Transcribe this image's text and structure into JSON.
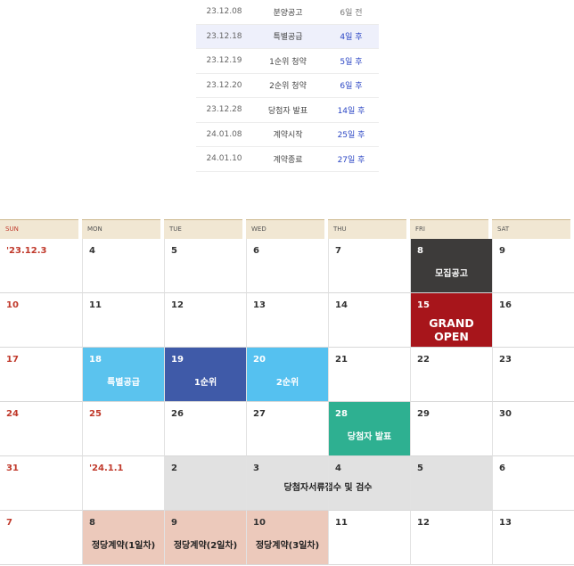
{
  "schedule": [
    {
      "date": "23.12.08",
      "event": "분양공고",
      "dday": "6일 전",
      "future": false,
      "highlight": false
    },
    {
      "date": "23.12.18",
      "event": "특별공급",
      "dday": "4일 후",
      "future": true,
      "highlight": true
    },
    {
      "date": "23.12.19",
      "event": "1순위 청약",
      "dday": "5일 후",
      "future": true,
      "highlight": false
    },
    {
      "date": "23.12.20",
      "event": "2순위 청약",
      "dday": "6일 후",
      "future": true,
      "highlight": false
    },
    {
      "date": "23.12.28",
      "event": "당첨자 발표",
      "dday": "14일 후",
      "future": true,
      "highlight": false
    },
    {
      "date": "24.01.08",
      "event": "계약시작",
      "dday": "25일 후",
      "future": true,
      "highlight": false
    },
    {
      "date": "24.01.10",
      "event": "계약종료",
      "dday": "27일 후",
      "future": true,
      "highlight": false
    }
  ],
  "calendar": {
    "weekdays": [
      "SUN",
      "MON",
      "TUE",
      "WED",
      "THU",
      "FRI",
      "SAT"
    ],
    "colors": {
      "recruit": "#3d3b3a",
      "open": "#a7151b",
      "special": "#5bc3ee",
      "first": "#3f5aa8",
      "second": "#55c1f0",
      "winner": "#2eb091",
      "docs": "#e1e1e1",
      "contract": "#ecc9bb",
      "sunday": "#c0392b"
    },
    "weeks": [
      {
        "days": [
          {
            "num": "'23.12.3",
            "red": true
          },
          {
            "num": "4"
          },
          {
            "num": "5"
          },
          {
            "num": "6"
          },
          {
            "num": "7"
          },
          {
            "num": "8",
            "event": "모집공고",
            "bg": "#3d3b3a",
            "white": true
          },
          {
            "num": "9"
          }
        ]
      },
      {
        "days": [
          {
            "num": "10",
            "red": true
          },
          {
            "num": "11"
          },
          {
            "num": "12"
          },
          {
            "num": "13"
          },
          {
            "num": "14"
          },
          {
            "num": "15",
            "event": "GRAND OPEN",
            "bg": "#a7151b",
            "white": true,
            "big": true
          },
          {
            "num": "16"
          }
        ]
      },
      {
        "days": [
          {
            "num": "17",
            "red": true
          },
          {
            "num": "18",
            "event": "특별공급",
            "bg": "#5bc3ee",
            "white": true
          },
          {
            "num": "19",
            "event": "1순위",
            "bg": "#3f5aa8",
            "white": true
          },
          {
            "num": "20",
            "event": "2순위",
            "bg": "#55c1f0",
            "white": true
          },
          {
            "num": "21"
          },
          {
            "num": "22"
          },
          {
            "num": "23"
          }
        ]
      },
      {
        "days": [
          {
            "num": "24",
            "red": true
          },
          {
            "num": "25",
            "red": true
          },
          {
            "num": "26"
          },
          {
            "num": "27"
          },
          {
            "num": "28",
            "event": "당첨자 발표",
            "bg": "#2eb091",
            "white": true
          },
          {
            "num": "29"
          },
          {
            "num": "30"
          }
        ]
      },
      {
        "days": [
          {
            "num": "31",
            "red": true
          },
          {
            "num": "'24.1.1",
            "red": true
          },
          {
            "num": "2"
          },
          {
            "num": "3"
          },
          {
            "num": "4"
          },
          {
            "num": "5"
          },
          {
            "num": "6"
          }
        ],
        "band": {
          "from": 2,
          "to": 5,
          "event": "당첨자서류접수 및 검수"
        }
      },
      {
        "days": [
          {
            "num": "7",
            "red": true
          },
          {
            "num": "8",
            "event": "정당계약(1일차)",
            "bg": "#ecc9bb",
            "darktext": true
          },
          {
            "num": "9",
            "event": "정당계약(2일차)",
            "bg": "#ecc9bb",
            "darktext": true
          },
          {
            "num": "10",
            "event": "정당계약(3일차)",
            "bg": "#ecc9bb",
            "darktext": true
          },
          {
            "num": "11"
          },
          {
            "num": "12"
          },
          {
            "num": "13"
          }
        ]
      }
    ]
  }
}
